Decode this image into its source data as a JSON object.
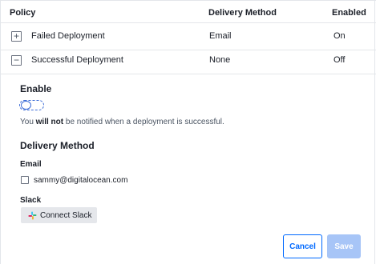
{
  "table": {
    "headers": {
      "policy": "Policy",
      "method": "Delivery Method",
      "enabled": "Enabled"
    },
    "rows": [
      {
        "toggle": "+",
        "name": "Failed Deployment",
        "method": "Email",
        "enabled": "On"
      },
      {
        "toggle": "−",
        "name": "Successful Deployment",
        "method": "None",
        "enabled": "Off"
      }
    ]
  },
  "details": {
    "enable_title": "Enable",
    "switch_on": false,
    "notice_prefix": "You ",
    "notice_bold": "will not",
    "notice_suffix": " be notified when a deployment is successful.",
    "delivery_title": "Delivery Method",
    "email_label": "Email",
    "email_value": "sammy@digitalocean.com",
    "email_checked": false,
    "slack_label": "Slack",
    "slack_button": "Connect Slack",
    "slack_icon": "slack-logo-icon"
  },
  "actions": {
    "cancel": "Cancel",
    "save": "Save"
  },
  "colors": {
    "accent": "#0069ff",
    "save_disabled": "#a7c5f7",
    "border": "#e3e6ea"
  }
}
